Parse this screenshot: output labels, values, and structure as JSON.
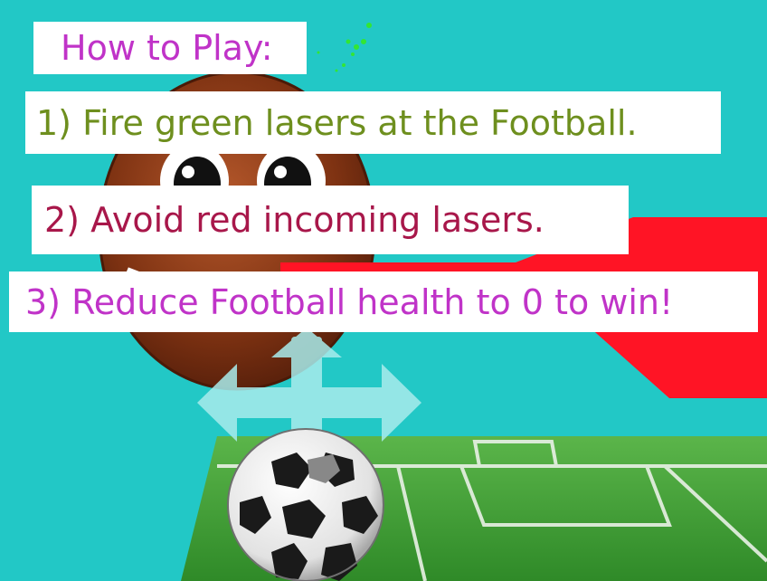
{
  "instructions": {
    "heading": "How to Play:",
    "step1": "1) Fire green lasers at the Football.",
    "step2": "2) Avoid red incoming lasers.",
    "step3": "3) Reduce Football health to 0 to win!"
  },
  "colors": {
    "sky": "#22c8c6",
    "heading_text": "#c033c8",
    "step1_text": "#6e8f1e",
    "step2_text": "#a8174a",
    "step3_text": "#c033c8",
    "enemy_laser": "#ff1425",
    "player_laser": "#33e633",
    "field_grass": "#3f9b34",
    "field_lines": "#e9f1e6"
  },
  "icons": {
    "move_control": "four-way-arrow-icon",
    "enemy": "football-enemy-face",
    "player": "soccer-ball-player"
  }
}
